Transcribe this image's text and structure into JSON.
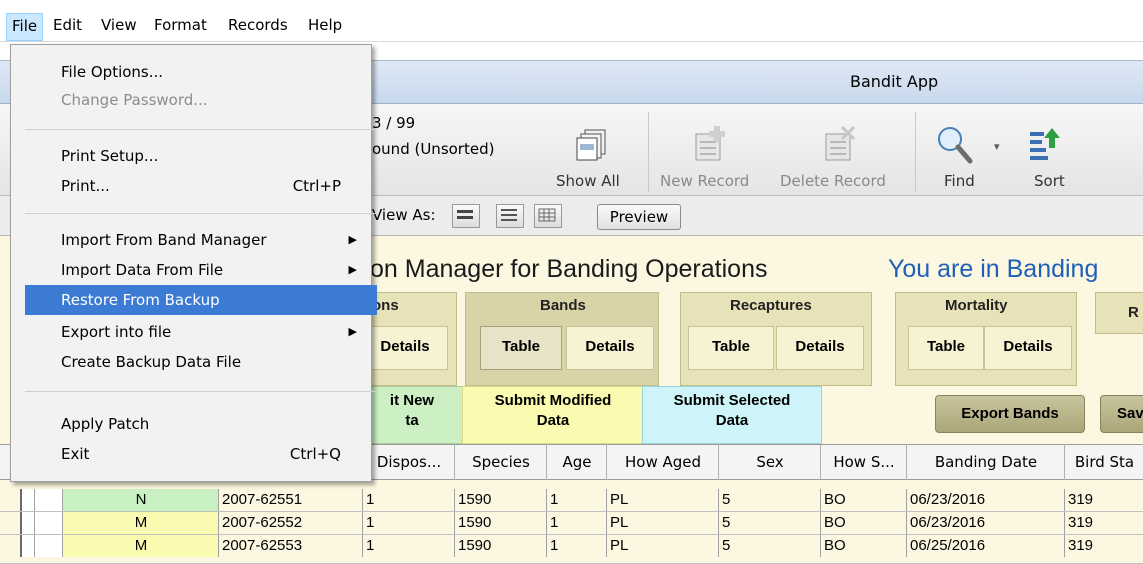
{
  "menubar": {
    "items": [
      "File",
      "Edit",
      "View",
      "Format",
      "Records",
      "Help"
    ]
  },
  "window": {
    "title": "Bandit App"
  },
  "toolbar": {
    "record_count": "3 / 99",
    "found_status": "ound (Unsorted)",
    "show_all": "Show All",
    "new_record": "New Record",
    "delete_record": "Delete Record",
    "find": "Find",
    "sort": "Sort",
    "view_as": "View As:",
    "preview": "Preview"
  },
  "layout": {
    "heading": "on Manager for Banding Operations",
    "status": "You are in Banding",
    "groups": {
      "first": {
        "title": "ons",
        "details": "Details"
      },
      "bands": {
        "title": "Bands",
        "table": "Table",
        "details": "Details"
      },
      "recaptures": {
        "title": "Recaptures",
        "table": "Table",
        "details": "Details"
      },
      "mortality": {
        "title": "Mortality",
        "table": "Table",
        "details": "Details"
      },
      "next": {
        "title": "R"
      }
    },
    "actions": {
      "submit_new_1": "it New",
      "submit_new_2": "ta",
      "submit_modified_1": "Submit Modified",
      "submit_modified_2": "Data",
      "submit_selected_1": "Submit Selected",
      "submit_selected_2": "Data",
      "export_bands": "Export Bands",
      "save": "Sav"
    }
  },
  "table": {
    "headers": [
      "Dispos...",
      "Species",
      "Age",
      "How Aged",
      "Sex",
      "How S...",
      "Banding Date",
      "Bird Sta"
    ],
    "rows": [
      {
        "flag": "N",
        "band": "2007-62551",
        "dispos": "1",
        "species": "1590",
        "age": "1",
        "how_aged": "PL",
        "sex": "5",
        "how_sexed": "BO",
        "date": "06/23/2016",
        "status": "319"
      },
      {
        "flag": "M",
        "band": "2007-62552",
        "dispos": "1",
        "species": "1590",
        "age": "1",
        "how_aged": "PL",
        "sex": "5",
        "how_sexed": "BO",
        "date": "06/23/2016",
        "status": "319"
      },
      {
        "flag": "M",
        "band": "2007-62553",
        "dispos": "1",
        "species": "1590",
        "age": "1",
        "how_aged": "PL",
        "sex": "5",
        "how_sexed": "BO",
        "date": "06/25/2016",
        "status": "319"
      }
    ]
  },
  "file_menu": {
    "file_options": "File Options...",
    "change_password": "Change Password...",
    "print_setup": "Print Setup...",
    "print": "Print...",
    "print_shortcut": "Ctrl+P",
    "import_band_manager": "Import From Band Manager",
    "import_data_file": "Import Data From File",
    "restore_backup": "Restore From Backup",
    "export_file": "Export into file",
    "create_backup": "Create Backup Data File",
    "apply_patch": "Apply Patch",
    "exit": "Exit",
    "exit_shortcut": "Ctrl+Q"
  },
  "colors": {
    "menu_highlight": "#3c7bd4",
    "layout_background": "#fbf7e0",
    "status_text": "#1f5fb8",
    "group_background": "#e8e2b8"
  }
}
